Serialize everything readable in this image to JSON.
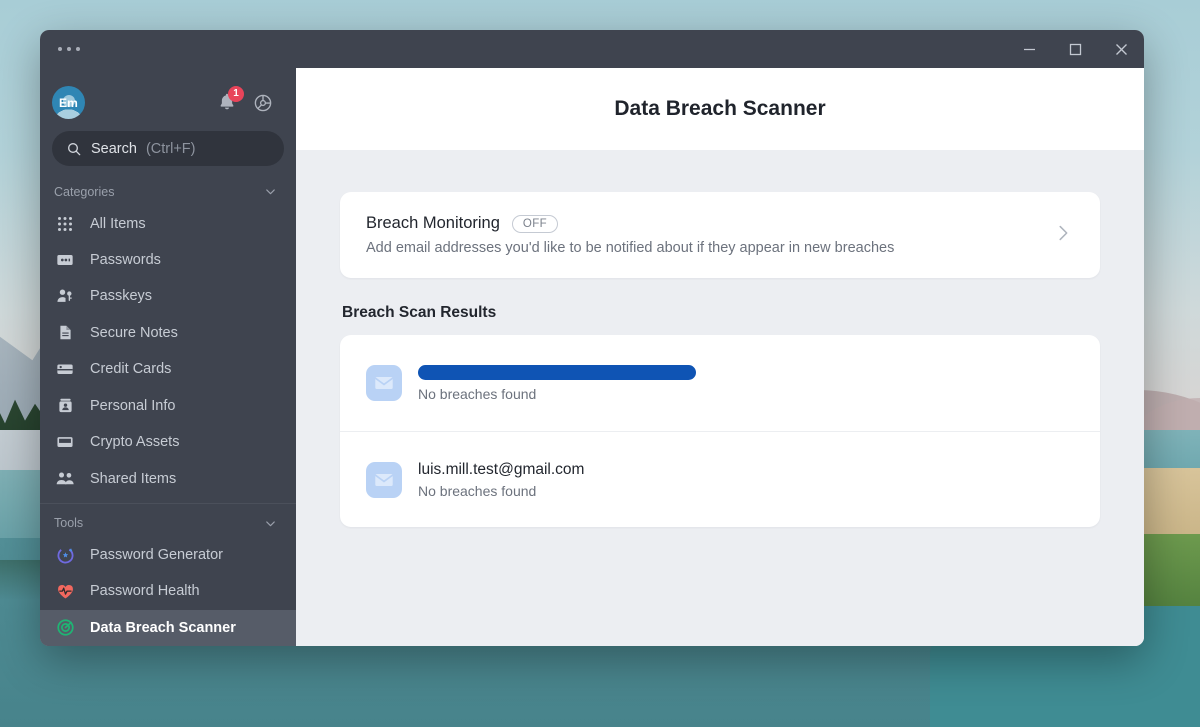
{
  "window": {
    "titlebar": {
      "menu_icon": "kebab-menu-icon",
      "minimize_label": "Minimize",
      "maximize_label": "Maximize",
      "close_label": "Close"
    }
  },
  "sidebar": {
    "account": {
      "initials": "Em",
      "avatar_name": "user-avatar"
    },
    "notifications": {
      "icon": "bell-icon",
      "badge_count": "1"
    },
    "settings": {
      "icon": "gear-icon"
    },
    "search": {
      "label": "Search",
      "shortcut": "(Ctrl+F)",
      "placeholder": "Search (Ctrl+F)",
      "icon": "search-icon"
    },
    "sections": [
      {
        "title": "Categories",
        "chevron": "chevron-down-icon",
        "items": [
          {
            "label": "All Items",
            "icon": "grid-icon",
            "active": false
          },
          {
            "label": "Passwords",
            "icon": "password-card-icon",
            "active": false
          },
          {
            "label": "Passkeys",
            "icon": "passkey-person-key-icon",
            "active": false
          },
          {
            "label": "Secure Notes",
            "icon": "note-document-icon",
            "active": false
          },
          {
            "label": "Credit Cards",
            "icon": "credit-card-icon",
            "active": false
          },
          {
            "label": "Personal Info",
            "icon": "id-badge-icon",
            "active": false
          },
          {
            "label": "Crypto Assets",
            "icon": "wallet-icon",
            "active": false
          },
          {
            "label": "Shared Items",
            "icon": "two-people-icon",
            "active": false
          }
        ]
      },
      {
        "title": "Tools",
        "chevron": "chevron-down-icon",
        "items": [
          {
            "label": "Password Generator",
            "icon": "refresh-star-icon",
            "active": false
          },
          {
            "label": "Password Health",
            "icon": "heart-pulse-icon",
            "active": false
          },
          {
            "label": "Data Breach Scanner",
            "icon": "radar-target-icon",
            "active": true
          }
        ]
      }
    ]
  },
  "header": {
    "title": "Data Breach Scanner"
  },
  "breach_monitoring": {
    "title": "Breach Monitoring",
    "status_badge": "OFF",
    "description": "Add email addresses you'd like to be notified about if they appear in new breaches",
    "chevron": "chevron-right-icon"
  },
  "results": {
    "section_title": "Breach Scan Results",
    "rows": [
      {
        "email": "",
        "redacted": true,
        "status": "No breaches found",
        "icon": "envelope-icon"
      },
      {
        "email": "luis.mill.test@gmail.com",
        "redacted": false,
        "status": "No breaches found",
        "icon": "envelope-icon"
      }
    ]
  },
  "colors": {
    "sidebar_bg": "#3f444f",
    "content_bg": "#eceef2",
    "accent_badge": "#e8445a",
    "redaction": "#0f54b4",
    "active_item": "#565c68",
    "mail_icon_bg": "#b9d2f5"
  }
}
